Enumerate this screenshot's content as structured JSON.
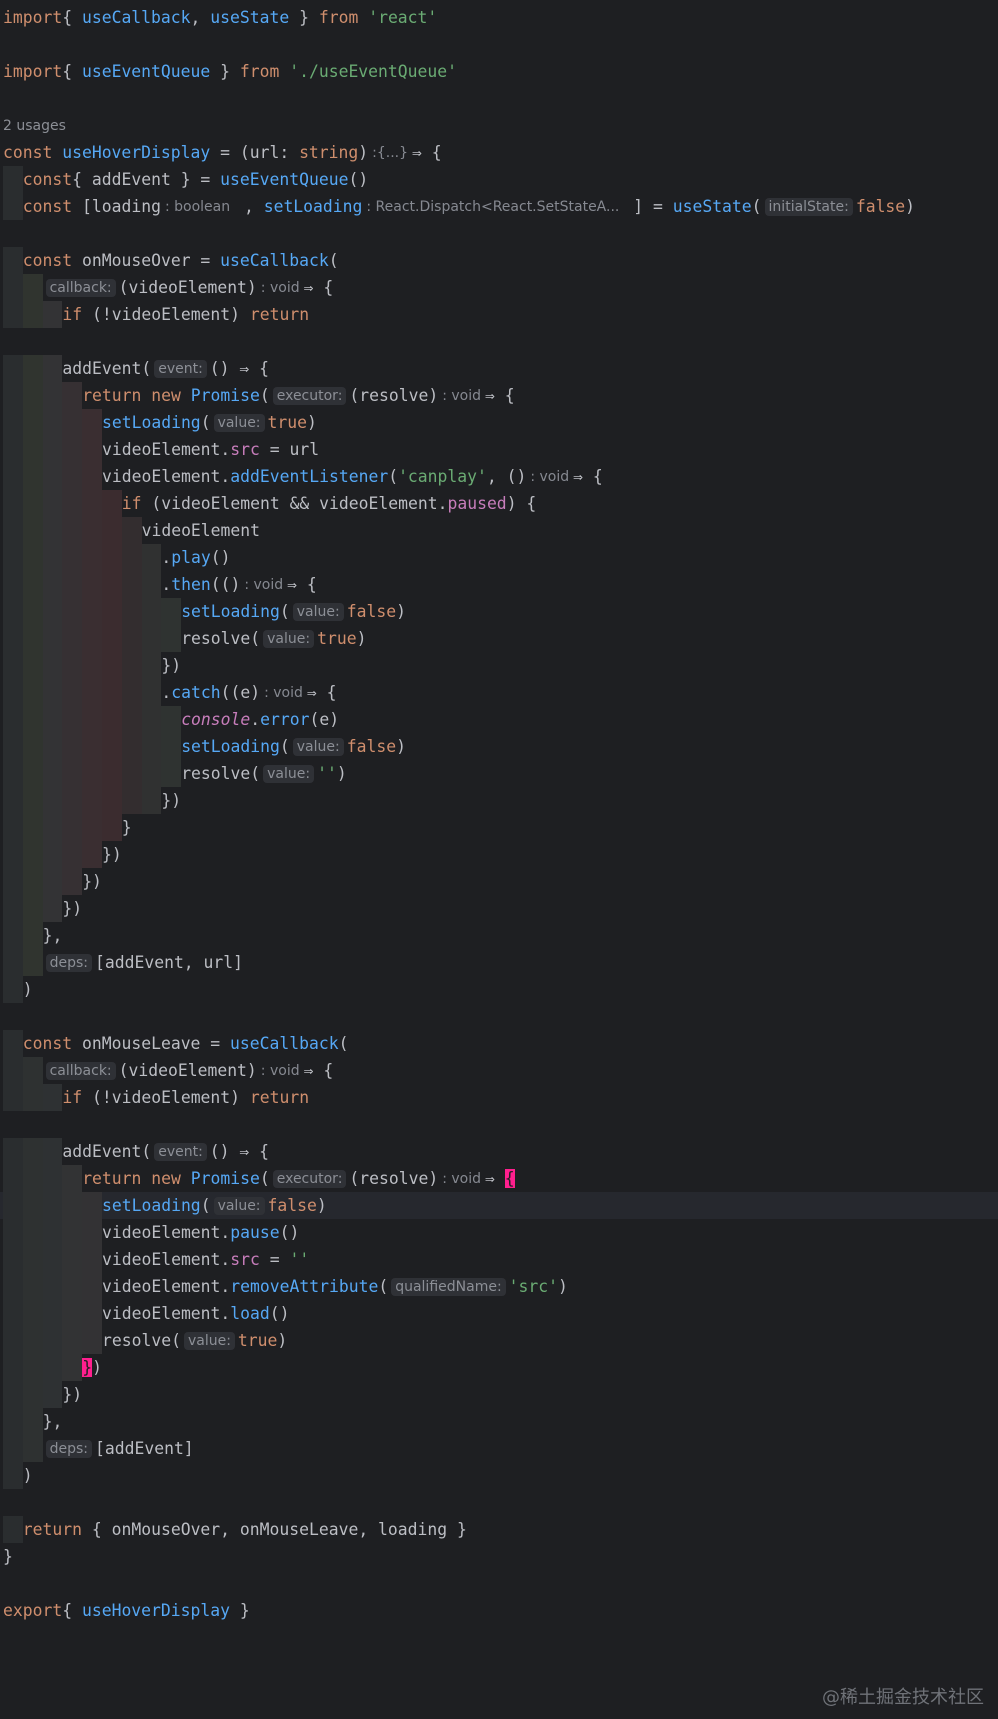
{
  "editor": {
    "lines": [
      [
        [
          "kw",
          "import"
        ],
        [
          "",
          "{ "
        ],
        [
          "fn",
          "useCallback"
        ],
        [
          "",
          ", "
        ],
        [
          "fn",
          "useState"
        ],
        [
          "",
          " } "
        ],
        [
          "kw",
          "from"
        ],
        [
          "",
          " "
        ],
        [
          "str",
          "'react'"
        ]
      ],
      [],
      [
        [
          "kw",
          "import"
        ],
        [
          "",
          "{ "
        ],
        [
          "fn",
          "useEventQueue"
        ],
        [
          "",
          " } "
        ],
        [
          "kw",
          "from"
        ],
        [
          "",
          " "
        ],
        [
          "str",
          "'./useEventQueue'"
        ]
      ],
      [],
      [
        [
          "usage",
          "2 usages"
        ]
      ],
      [
        [
          "kw",
          "const"
        ],
        [
          "",
          " "
        ],
        [
          "fn",
          "useHoverDisplay"
        ],
        [
          "",
          " = (url: "
        ],
        [
          "kw",
          "string"
        ],
        [
          "",
          ")"
        ],
        [
          "thint",
          ":{...}"
        ],
        [
          "",
          "⇒ {"
        ]
      ],
      [
        [
          "kw",
          "const"
        ],
        [
          "",
          "{ addEvent } = "
        ],
        [
          "fn",
          "useEventQueue"
        ],
        [
          "",
          "()"
        ]
      ],
      [
        [
          "kw",
          "const"
        ],
        [
          "",
          " [loading"
        ],
        [
          "thint",
          ": boolean"
        ],
        [
          "",
          " , "
        ],
        [
          "fn",
          "setLoading"
        ],
        [
          "thint",
          ": React.Dispatch<React.SetStateA..."
        ],
        [
          "",
          " ] = "
        ],
        [
          "fn",
          "useState"
        ],
        [
          "",
          "("
        ],
        [
          "hint",
          "initialState:"
        ],
        [
          "kw",
          "false"
        ],
        [
          "",
          ")"
        ]
      ],
      [],
      [
        [
          "kw",
          "const"
        ],
        [
          "",
          " onMouseOver = "
        ],
        [
          "fn",
          "useCallback"
        ],
        [
          "",
          "("
        ]
      ],
      [
        [
          "hint",
          "callback:"
        ],
        [
          "",
          "(videoElement)"
        ],
        [
          "thint",
          ": void"
        ],
        [
          "",
          "⇒ {"
        ]
      ],
      [
        [
          "kw",
          "if"
        ],
        [
          "",
          " (!videoElement) "
        ],
        [
          "kw",
          "return"
        ]
      ],
      [],
      [
        [
          "",
          "addEvent("
        ],
        [
          "hint",
          "event:"
        ],
        [
          "",
          "() ⇒ {"
        ]
      ],
      [
        [
          "kw",
          "return"
        ],
        [
          "",
          " "
        ],
        [
          "kw",
          "new"
        ],
        [
          "",
          " "
        ],
        [
          "fn",
          "Promise"
        ],
        [
          "",
          "("
        ],
        [
          "hint",
          "executor:"
        ],
        [
          "",
          "(resolve)"
        ],
        [
          "thint",
          ": void"
        ],
        [
          "",
          "⇒ {"
        ]
      ],
      [
        [
          "fn",
          "setLoading"
        ],
        [
          "",
          "("
        ],
        [
          "hint",
          "value:"
        ],
        [
          "kw",
          "true"
        ],
        [
          "",
          ")"
        ]
      ],
      [
        [
          "",
          "videoElement."
        ],
        [
          "prop",
          "src"
        ],
        [
          "",
          " = url"
        ]
      ],
      [
        [
          "",
          "videoElement."
        ],
        [
          "fn",
          "addEventListener"
        ],
        [
          "",
          "("
        ],
        [
          "str",
          "'canplay'"
        ],
        [
          "",
          ", ()"
        ],
        [
          "thint",
          ": void"
        ],
        [
          "",
          "⇒ {"
        ]
      ],
      [
        [
          "kw",
          "if"
        ],
        [
          "",
          " (videoElement && videoElement."
        ],
        [
          "prop",
          "paused"
        ],
        [
          "",
          ") {"
        ]
      ],
      [
        [
          "",
          "videoElement"
        ]
      ],
      [
        [
          "",
          "."
        ],
        [
          "fn",
          "play"
        ],
        [
          "",
          "()"
        ]
      ],
      [
        [
          "",
          "."
        ],
        [
          "fn",
          "then"
        ],
        [
          "",
          "(()"
        ],
        [
          "thint",
          ": void"
        ],
        [
          "",
          "⇒ {"
        ]
      ],
      [
        [
          "fn",
          "setLoading"
        ],
        [
          "",
          "("
        ],
        [
          "hint",
          "value:"
        ],
        [
          "kw",
          "false"
        ],
        [
          "",
          ")"
        ]
      ],
      [
        [
          "",
          "resolve("
        ],
        [
          "hint",
          "value:"
        ],
        [
          "kw",
          "true"
        ],
        [
          "",
          ")"
        ]
      ],
      [
        [
          "",
          "})"
        ]
      ],
      [
        [
          "",
          "."
        ],
        [
          "fn",
          "catch"
        ],
        [
          "",
          "((e)"
        ],
        [
          "thint",
          ": void"
        ],
        [
          "",
          "⇒ {"
        ]
      ],
      [
        [
          "it",
          "console"
        ],
        [
          "",
          "."
        ],
        [
          "fn",
          "error"
        ],
        [
          "",
          "(e)"
        ]
      ],
      [
        [
          "fn",
          "setLoading"
        ],
        [
          "",
          "("
        ],
        [
          "hint",
          "value:"
        ],
        [
          "kw",
          "false"
        ],
        [
          "",
          ")"
        ]
      ],
      [
        [
          "",
          "resolve("
        ],
        [
          "hint",
          "value:"
        ],
        [
          "str",
          "''"
        ],
        [
          "",
          ")"
        ]
      ],
      [
        [
          "",
          "})"
        ]
      ],
      [
        [
          "",
          "}"
        ]
      ],
      [
        [
          "",
          "})"
        ]
      ],
      [
        [
          "",
          "})"
        ]
      ],
      [
        [
          "",
          "})"
        ]
      ],
      [
        [
          "",
          "},"
        ]
      ],
      [
        [
          "hint",
          "deps:"
        ],
        [
          "",
          "[addEvent, url]"
        ]
      ],
      [
        [
          "",
          ")"
        ]
      ],
      [],
      [
        [
          "kw",
          "const"
        ],
        [
          "",
          " onMouseLeave = "
        ],
        [
          "fn",
          "useCallback"
        ],
        [
          "",
          "("
        ]
      ],
      [
        [
          "hint",
          "callback:"
        ],
        [
          "",
          "(videoElement)"
        ],
        [
          "thint",
          ": void"
        ],
        [
          "",
          "⇒ {"
        ]
      ],
      [
        [
          "kw",
          "if"
        ],
        [
          "",
          " (!videoElement) "
        ],
        [
          "kw",
          "return"
        ]
      ],
      [],
      [
        [
          "",
          "addEvent("
        ],
        [
          "hint",
          "event:"
        ],
        [
          "",
          "() ⇒ {"
        ]
      ],
      [
        [
          "kw",
          "return"
        ],
        [
          "",
          " "
        ],
        [
          "kw",
          "new"
        ],
        [
          "",
          " "
        ],
        [
          "fn",
          "Promise"
        ],
        [
          "",
          "("
        ],
        [
          "hint",
          "executor:"
        ],
        [
          "",
          "(resolve)"
        ],
        [
          "thint",
          ": void"
        ],
        [
          "",
          "⇒ "
        ],
        [
          "bm",
          "{"
        ]
      ],
      [
        [
          "fn",
          "setLoading"
        ],
        [
          "",
          "("
        ],
        [
          "hint",
          "value:"
        ],
        [
          "kw",
          "false"
        ],
        [
          "",
          ")"
        ]
      ],
      [
        [
          "",
          "videoElement."
        ],
        [
          "fn",
          "pause"
        ],
        [
          "",
          "()"
        ]
      ],
      [
        [
          "",
          "videoElement."
        ],
        [
          "prop",
          "src"
        ],
        [
          "",
          " = "
        ],
        [
          "str",
          "''"
        ]
      ],
      [
        [
          "",
          "videoElement."
        ],
        [
          "fn",
          "removeAttribute"
        ],
        [
          "",
          "("
        ],
        [
          "hint",
          "qualifiedName:"
        ],
        [
          "str",
          "'src'"
        ],
        [
          "",
          ")"
        ]
      ],
      [
        [
          "",
          "videoElement."
        ],
        [
          "fn",
          "load"
        ],
        [
          "",
          "()"
        ]
      ],
      [
        [
          "",
          "resolve("
        ],
        [
          "hint",
          "value:"
        ],
        [
          "kw",
          "true"
        ],
        [
          "",
          ")"
        ]
      ],
      [
        [
          "bm",
          "}"
        ],
        [
          "",
          ")"
        ]
      ],
      [
        [
          "",
          "})"
        ]
      ],
      [
        [
          "",
          "},"
        ]
      ],
      [
        [
          "hint",
          "deps:"
        ],
        [
          "",
          "[addEvent]"
        ]
      ],
      [
        [
          "",
          ")"
        ]
      ],
      [],
      [
        [
          "kw",
          "return"
        ],
        [
          "",
          " { onMouseOver, onMouseLeave, loading }"
        ]
      ],
      [
        [
          "",
          "}"
        ]
      ],
      [],
      [
        [
          "kw",
          "export"
        ],
        [
          "",
          "{ "
        ],
        [
          "fn",
          "useHoverDisplay"
        ],
        [
          "",
          " }"
        ]
      ]
    ],
    "indents": [
      0,
      0,
      0,
      0,
      0,
      0,
      1,
      1,
      0,
      1,
      2,
      3,
      0,
      3,
      4,
      5,
      5,
      5,
      6,
      7,
      8,
      8,
      9,
      9,
      8,
      8,
      9,
      9,
      9,
      8,
      6,
      5,
      4,
      3,
      2,
      2,
      1,
      0,
      1,
      2,
      3,
      0,
      3,
      4,
      5,
      5,
      5,
      5,
      5,
      5,
      4,
      3,
      2,
      2,
      1,
      0,
      1,
      0,
      0,
      0
    ],
    "current_line": 44
  },
  "watermark": "@稀土掘金技术社区",
  "colors": {
    "background": "#1e1f22",
    "keyword": "#cf8e6d",
    "function": "#56a8f5",
    "string": "#6aab73",
    "property": "#c77dbb",
    "bracket_match": "#ff1f8e"
  }
}
